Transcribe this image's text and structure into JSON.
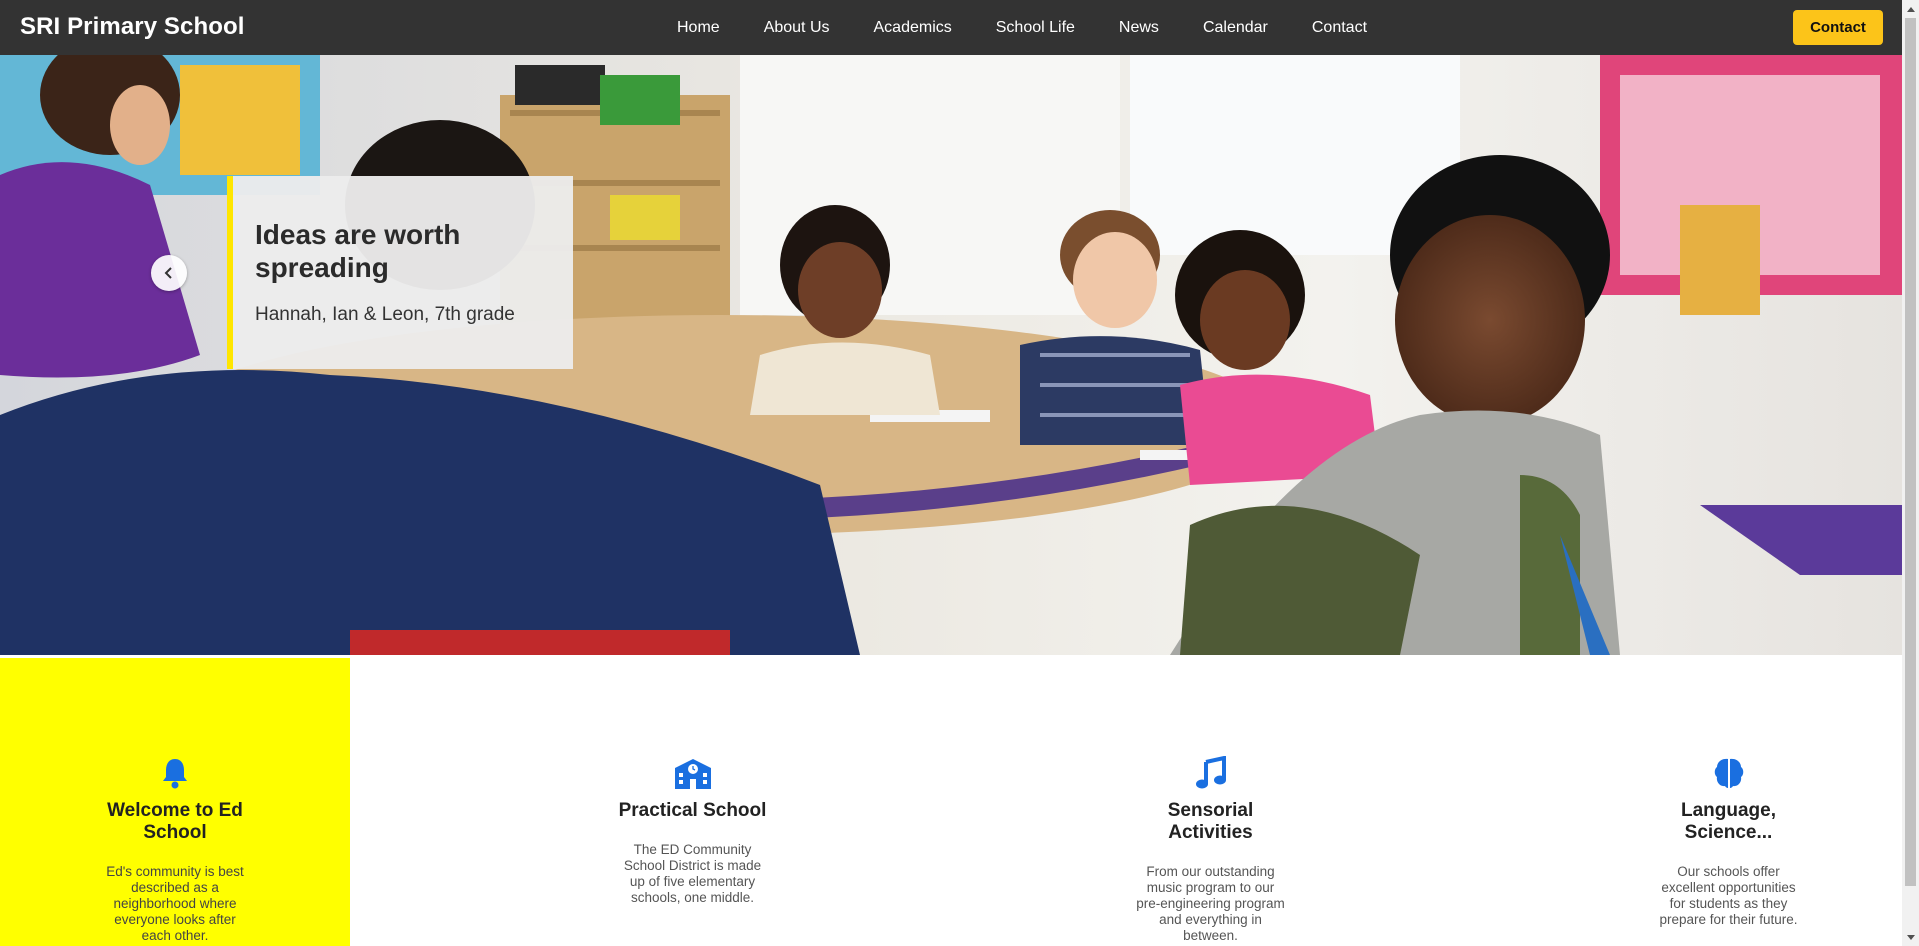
{
  "navbar": {
    "brand": "SRI Primary School",
    "links": [
      "Home",
      "About Us",
      "Academics",
      "School Life",
      "News",
      "Calendar",
      "Contact"
    ],
    "cta_label": "Contact"
  },
  "hero": {
    "caption_title": "Ideas are worth spreading",
    "caption_sub": "Hannah, Ian & Leon, 7th grade",
    "prev_icon": "chevron-left-icon"
  },
  "features": [
    {
      "icon": "bell-icon",
      "title": "Welcome to Ed School",
      "description": "Ed's community is best described as a neighborhood where everyone looks after each other."
    },
    {
      "icon": "school-building-icon",
      "title": "Practical School",
      "description": "The ED Community School District is made up of five elementary schools, one middle."
    },
    {
      "icon": "music-note-icon",
      "title": "Sensorial Activities",
      "description": "From our outstanding music program to our pre-engineering program and everything in between."
    },
    {
      "icon": "brain-icon",
      "title": "Language, Science...",
      "description": "Our schools offer excellent opportunities for students as they prepare for their future."
    }
  ],
  "colors": {
    "navbar_bg": "#333333",
    "cta_bg": "#fcc419",
    "highlight_bg": "#ffff00",
    "icon_blue": "#1a6fe0"
  }
}
